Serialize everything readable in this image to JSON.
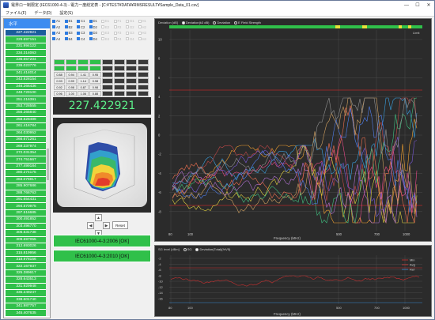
{
  "window": {
    "title": "電界ロー制限定 (IEC61000-4-3) - 電力ー度総定表 - [C:¥TEST¥DATA¥RMSRESULT¥Sample_Data_01.csv]",
    "controls": [
      "—",
      "☐",
      "✕"
    ]
  },
  "menu": [
    "ファイル(F)",
    "データ(D)",
    "設定(S)"
  ],
  "left_panel": {
    "header": "水平",
    "items": [
      "227.422921",
      "229.697151",
      "231.994122",
      "234.314063",
      "236.657204",
      "239.023776",
      "241.414014",
      "243.828154",
      "246.266436",
      "248.729100",
      "251.216391",
      "253.728555",
      "256.265840",
      "258.828499",
      "261.416784",
      "264.030952",
      "266.671261",
      "269.337974",
      "272.031354",
      "274.751667",
      "277.499184",
      "280.274175",
      "283.076917",
      "285.907686",
      "288.766763",
      "291.654431",
      "294.570975",
      "297.516685",
      "300.491852",
      "303.496770",
      "306.531738",
      "309.597055",
      "312.693026",
      "315.819956",
      "318.978156",
      "322.167937",
      "325.389617",
      "328.643513",
      "331.929948",
      "335.249247",
      "338.601740",
      "341.987757",
      "345.407635"
    ]
  },
  "checkboxes": [
    [
      "A1",
      "B1",
      "C1",
      "D1",
      "E1",
      "F1",
      "G1",
      "H1"
    ],
    [
      "A2",
      "B2",
      "C2",
      "D2",
      "E2",
      "F2",
      "G2",
      "H2"
    ],
    [
      "A3",
      "B3",
      "C3",
      "D3",
      "E3",
      "F3",
      "G3",
      "H3"
    ],
    [
      "A4",
      "B4",
      "C4",
      "D4",
      "E4",
      "F4",
      "G4",
      "H4"
    ]
  ],
  "value_grid": [
    [
      "0.88",
      "0.94",
      "1.41",
      "0.95"
    ],
    [
      "0.93",
      "0.99",
      "1.14",
      "0.98"
    ],
    [
      "0.92",
      "0.98",
      "0.87",
      "0.98"
    ],
    [
      "0.96",
      "1.00",
      "1.06",
      "0.88"
    ]
  ],
  "big_value": "227.422921",
  "nav": {
    "up": "▲",
    "down": "▼",
    "left": "◀",
    "right": "▶",
    "reset": "Reset"
  },
  "iec_results": [
    "IEC61000-4-3:2006 [OK]",
    "IEC61000-4-3:2010 [OK]"
  ],
  "colors": {
    "ok_green": "#30c04a",
    "list_selected": "#1b5e9c",
    "header_blue": "#3d8cf0"
  },
  "upper_chart": {
    "ylabel": "Deviation [dB]",
    "legend": [
      {
        "label": "Deviation(k3 dB)",
        "on": true
      },
      {
        "label": "Deviation",
        "on": false
      },
      {
        "label": "E Field Strength",
        "on": false
      }
    ],
    "status_label": "Limit",
    "yticks": [
      "10",
      "8",
      "6",
      "4",
      "2",
      "0",
      "-2",
      "-4",
      "-6",
      "-8"
    ],
    "xticks": [
      "80",
      "100",
      "500",
      "700",
      "1000"
    ],
    "xlabel": "Frequency (MHz)"
  },
  "lower_chart": {
    "ylabel": "SG level [dBm]",
    "legend": [
      {
        "label": "SG",
        "on": false
      },
      {
        "label": "Deviation(Total)(%V5)",
        "on": true
      }
    ],
    "yticks": [
      "-2",
      "-4",
      "-6",
      "-8",
      "-10",
      "-12",
      "-14",
      "-16"
    ],
    "xticks": [
      "80",
      "100",
      "500",
      "700",
      "1000"
    ],
    "xlabel": "Frequency (MHz)",
    "series_legend": [
      "Min",
      "Avg",
      "Ref"
    ]
  }
}
